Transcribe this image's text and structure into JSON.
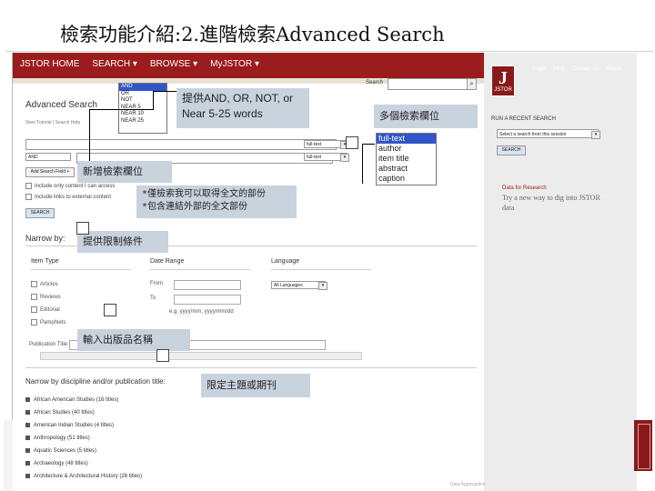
{
  "slide": {
    "title": "檢索功能介紹:2.進階檢索Advanced Search"
  },
  "jstor": {
    "nav": [
      "JSTOR HOME",
      "SEARCH ▾",
      "BROWSE ▾",
      "MyJSTOR ▾"
    ],
    "top_links": [
      "Login",
      "Help",
      "Contact Us",
      "About"
    ],
    "logo_text": "JSTOR",
    "search_label": "Search",
    "search_button": "⌕",
    "advanced_title": "Advanced Search",
    "advanced_sub": "View Tutorial | Search Help",
    "operators": [
      "AND",
      "OR",
      "NOT",
      "NEAR 5",
      "NEAR 10",
      "NEAR 25"
    ],
    "operator_selected": "AND",
    "operator_field_value": "AND",
    "field_select_1": "full-text",
    "field_select_2": "full-text",
    "fields": [
      "full-text",
      "author",
      "item title",
      "abstract",
      "caption"
    ],
    "field_selected": "full-text",
    "dropdown_glyph": "▾",
    "add_field_label": "Add Search Field +",
    "check_content": "Include only content I can access",
    "check_links": "Include links to external content",
    "search_button_label": "SEARCH",
    "narrow_by": "Narrow by:",
    "columns": {
      "item_type": "Item Type",
      "date_range": "Date Range",
      "language": "Language"
    },
    "item_types": [
      "Articles",
      "Reviews",
      "Editorial",
      "Pamphlets"
    ],
    "date_from_label": "From",
    "date_to_label": "To",
    "date_format": "e.g. yyyy/mm, yyyy/mm/dd",
    "language_value": "All Languages",
    "publication_title_label": "Publication Title:",
    "discipline_title": "Narrow by discipline and/or publication title:",
    "disciplines": [
      "African American Studies (16 titles)",
      "African Studies (40 titles)",
      "American Indian Studies (4 titles)",
      "Anthropology (51 titles)",
      "Aquatic Sciences (5 titles)",
      "Archaeology (48 titles)",
      "Architecture & Architectural History (26 titles)"
    ],
    "run_recent": "RUN A RECENT SEARCH",
    "recent_placeholder": "Select a search from this session",
    "recent_button": "SEARCH",
    "data_for_research": "Data for Research",
    "dfr_text": "Try a new way to dig into JSTOR data",
    "footer_partial": "Data Aggregation"
  },
  "callouts": {
    "operators": "提供AND, OR, NOT, or Near 5-25 words",
    "fields": "多個檢索欄位",
    "add_field": "新增檢索欄位",
    "access_note_1": "*僅檢索我可以取得全文的部份",
    "access_note_2": "*包含連結外部的全文部份",
    "limit": "提供限制條件",
    "publication": "輸入出版品名稱",
    "discipline": "限定主題或期刊"
  },
  "colors": {
    "jstor_red": "#9b1c1c",
    "callout_bg": "#c9d3dd",
    "selection_blue": "#3056c7"
  }
}
